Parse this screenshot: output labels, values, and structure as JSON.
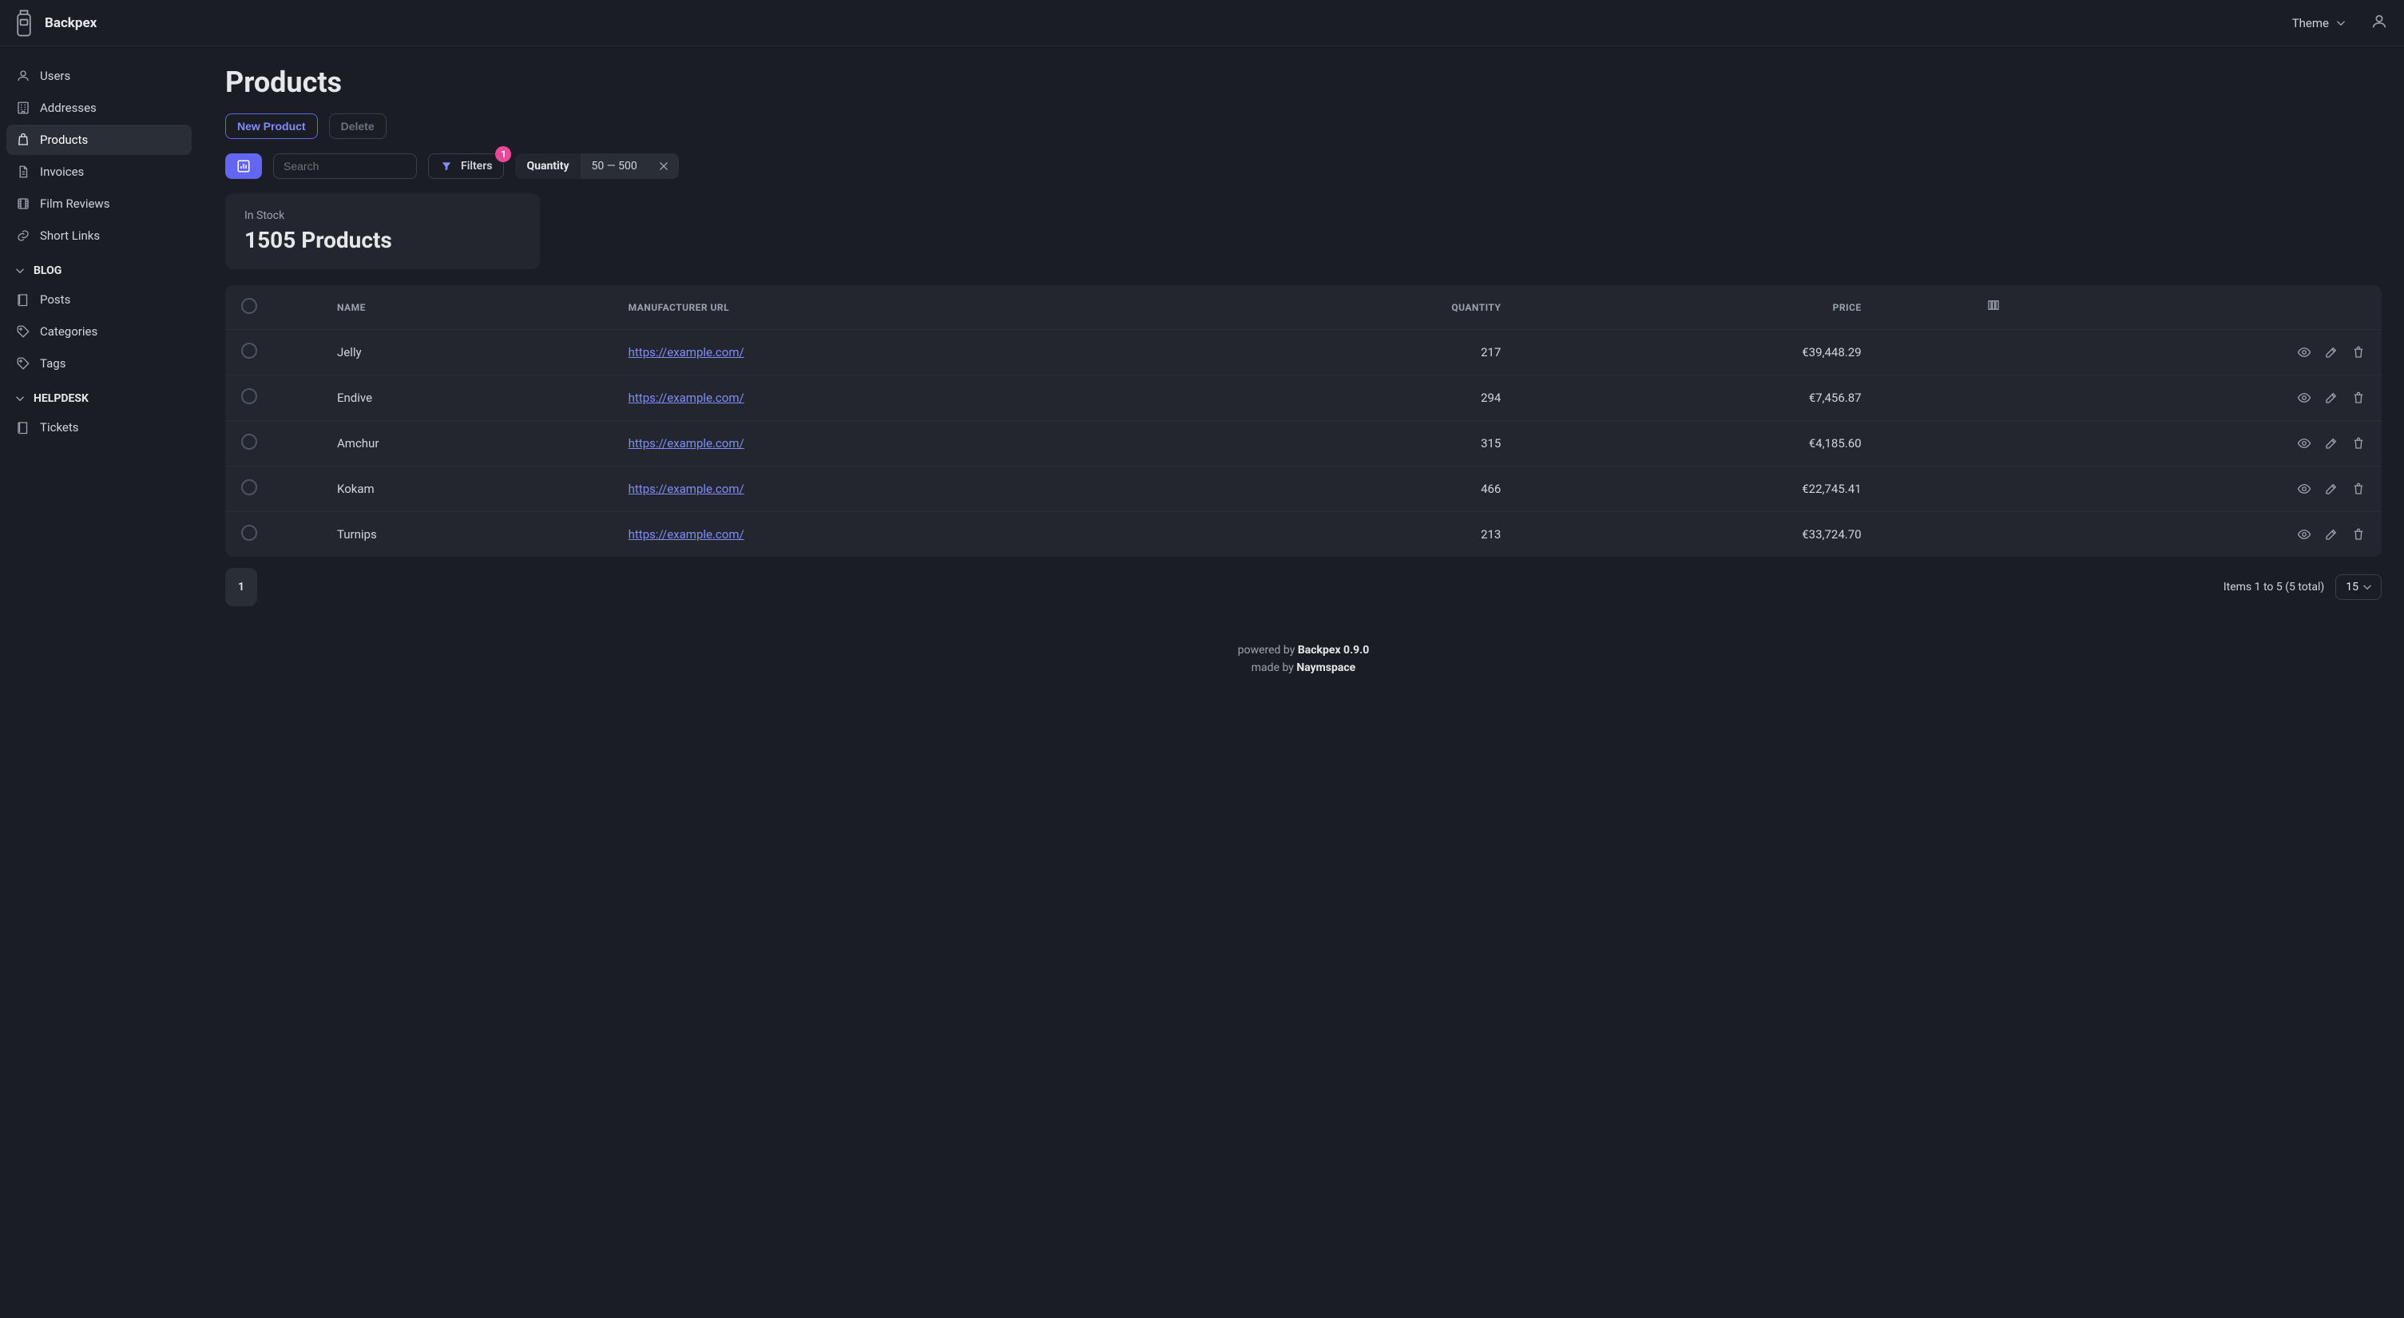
{
  "brand": {
    "name": "Backpex"
  },
  "topbar": {
    "theme_label": "Theme"
  },
  "sidebar": {
    "items": [
      {
        "label": "Users",
        "icon": "user-icon",
        "active": false
      },
      {
        "label": "Addresses",
        "icon": "building-icon",
        "active": false
      },
      {
        "label": "Products",
        "icon": "bag-icon",
        "active": true
      },
      {
        "label": "Invoices",
        "icon": "document-icon",
        "active": false
      },
      {
        "label": "Film Reviews",
        "icon": "film-icon",
        "active": false
      },
      {
        "label": "Short Links",
        "icon": "link-icon",
        "active": false
      }
    ],
    "sections": [
      {
        "title": "BLOG",
        "items": [
          {
            "label": "Posts",
            "icon": "book-icon"
          },
          {
            "label": "Categories",
            "icon": "tag-icon"
          },
          {
            "label": "Tags",
            "icon": "tag-icon"
          }
        ]
      },
      {
        "title": "HELPDESK",
        "items": [
          {
            "label": "Tickets",
            "icon": "book-icon"
          }
        ]
      }
    ]
  },
  "page": {
    "title": "Products",
    "new_button": "New Product",
    "delete_button": "Delete",
    "search_placeholder": "Search",
    "filters_label": "Filters",
    "filters_count": "1",
    "applied_filter": {
      "key": "Quantity",
      "value": "50 — 500"
    },
    "metric": {
      "label": "In Stock",
      "value": "1505 Products"
    }
  },
  "table": {
    "columns": {
      "name": "Name",
      "url": "Manufacturer URL",
      "qty": "Quantity",
      "price": "Price"
    },
    "rows": [
      {
        "name": "Jelly",
        "url": "https://example.com/",
        "qty": "217",
        "price": "€39,448.29"
      },
      {
        "name": "Endive",
        "url": "https://example.com/",
        "qty": "294",
        "price": "€7,456.87"
      },
      {
        "name": "Amchur",
        "url": "https://example.com/",
        "qty": "315",
        "price": "€4,185.60"
      },
      {
        "name": "Kokam",
        "url": "https://example.com/",
        "qty": "466",
        "price": "€22,745.41"
      },
      {
        "name": "Turnips",
        "url": "https://example.com/",
        "qty": "213",
        "price": "€33,724.70"
      }
    ]
  },
  "pagination": {
    "current_page": "1",
    "summary": "Items 1 to 5 (5 total)",
    "per_page": "15"
  },
  "footer": {
    "powered_by_prefix": "powered by ",
    "powered_by_name": "Backpex 0.9.0",
    "made_by_prefix": "made by ",
    "made_by_name": "Naymspace"
  }
}
